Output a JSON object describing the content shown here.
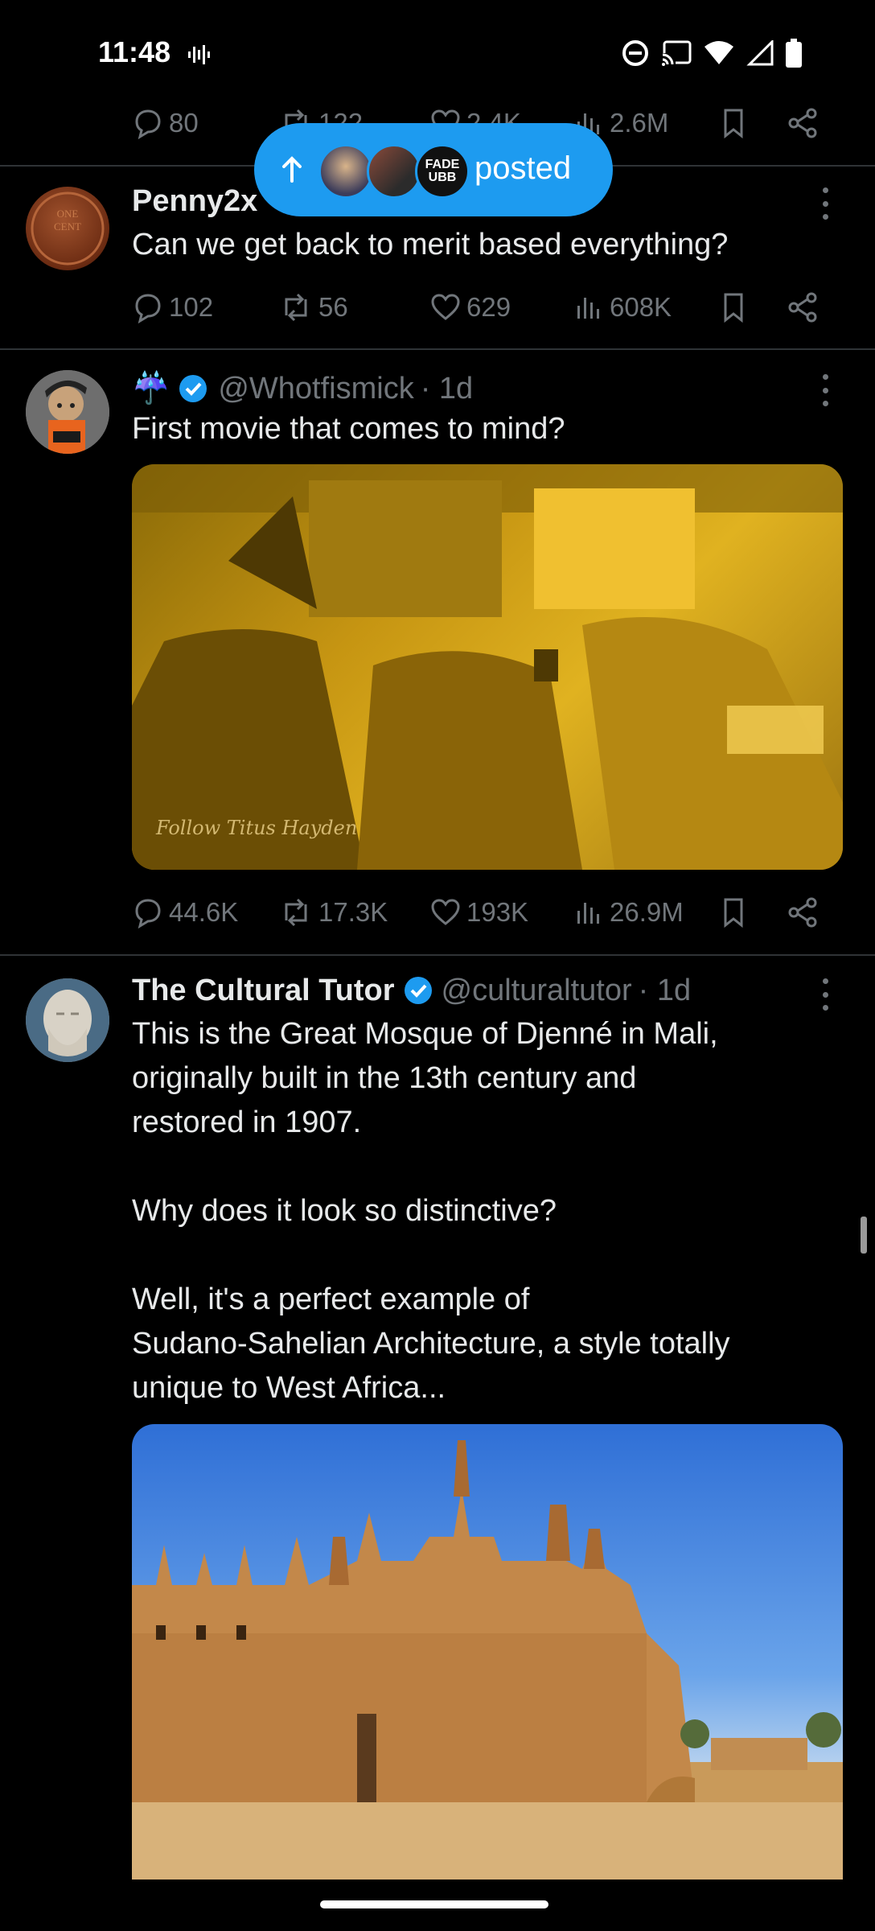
{
  "status_bar": {
    "time": "11:48",
    "icons": [
      "audio-wave-icon",
      "dnd-icon",
      "cast-icon",
      "wifi-icon",
      "signal-icon",
      "battery-icon"
    ]
  },
  "partial_tweet": {
    "stats": {
      "replies": "80",
      "reposts": "122",
      "likes": "2.4K",
      "views": "2.6M"
    }
  },
  "posted_pill": {
    "label": "posted",
    "avatar_3_text": "FADE\nUBB"
  },
  "tweets": [
    {
      "name": "Penny2x",
      "text": "Can we get back to merit based everything?",
      "stats": {
        "replies": "102",
        "reposts": "56",
        "likes": "629",
        "views": "608K"
      }
    },
    {
      "name_emoji": "☔",
      "handle": "@Whotfismick",
      "time": "· 1d",
      "text": "First movie that comes to mind?",
      "media_watermark": "Follow Titus Hayden",
      "stats": {
        "replies": "44.6K",
        "reposts": "17.3K",
        "likes": "193K",
        "views": "26.9M"
      }
    },
    {
      "name": "The Cultural Tutor",
      "handle": "@culturaltutor",
      "time": "· 1d",
      "text_lines": [
        "This is the Great Mosque of Djenné in Mali,",
        "originally built in the 13th century and",
        "restored in 1907.",
        "",
        "Why does it look so distinctive?",
        "",
        "Well, it's a perfect example of",
        "Sudano-Sahelian Architecture, a style totally",
        "unique to West Africa..."
      ]
    }
  ],
  "colors": {
    "accent": "#1d9bf0",
    "muted": "#71767b",
    "text": "#e7e9ea",
    "background": "#000000"
  }
}
